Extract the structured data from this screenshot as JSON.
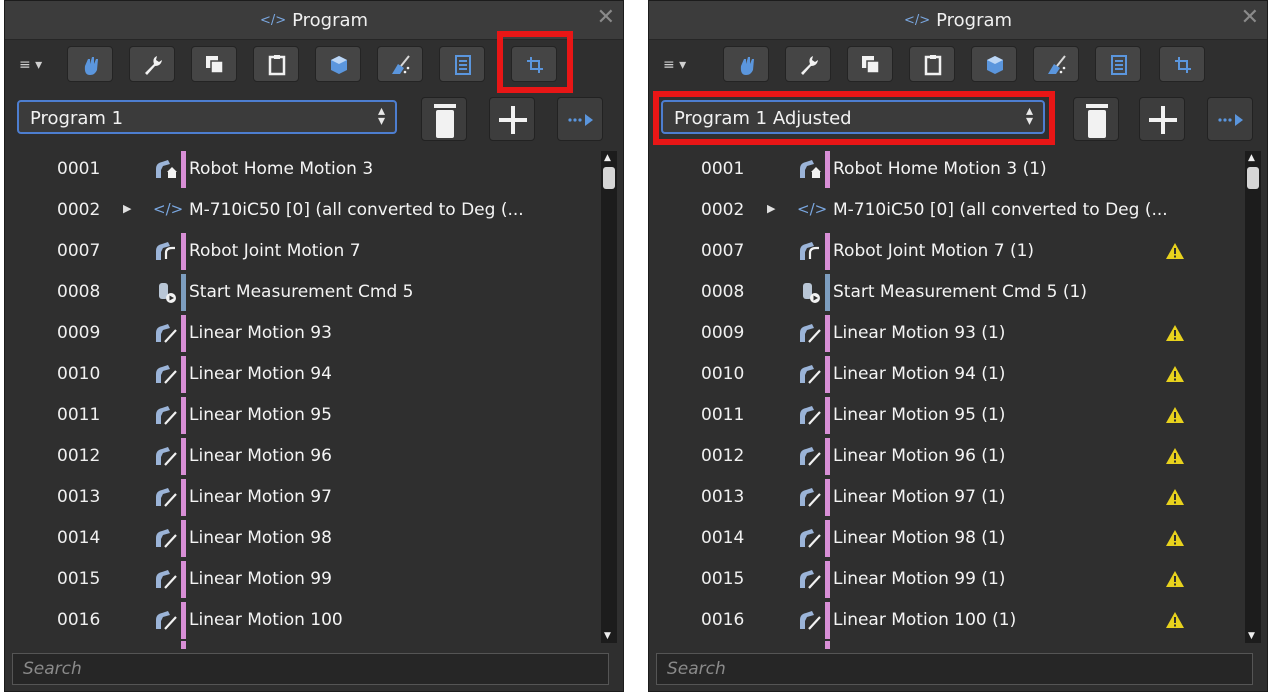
{
  "colors": {
    "panel_bg": "#2f2f2f",
    "accent_blue": "#4d7ed0",
    "highlight_red": "#e81616",
    "bar_pink": "#d88fd6",
    "bar_blue": "#7d9ec0",
    "warning_yellow": "#e8d21d"
  },
  "panels": [
    {
      "title": "Program",
      "toolbar_icons": [
        "hand-icon",
        "wrench-icon",
        "copy-icon",
        "clipboard-icon",
        "cube-icon",
        "broom-icon",
        "list-icon",
        "crop-icon"
      ],
      "highlighted": "crop-button",
      "program_select": {
        "value": "Program 1",
        "highlighted": false
      },
      "rows": [
        {
          "num": "0001",
          "label": "Robot Home Motion 3",
          "icon": "robot-home-icon",
          "bar": "pink",
          "warning": false,
          "expandable": false
        },
        {
          "num": "0002",
          "label": "M-710iC50 [0] (all converted to Deg (...",
          "icon": "code-icon",
          "bar": "none",
          "warning": false,
          "expandable": true
        },
        {
          "num": "0007",
          "label": "Robot Joint Motion 7",
          "icon": "robot-joint-icon",
          "bar": "pink",
          "warning": false,
          "expandable": false
        },
        {
          "num": "0008",
          "label": "Start Measurement Cmd 5",
          "icon": "measurement-icon",
          "bar": "blue",
          "warning": false,
          "expandable": false
        },
        {
          "num": "0009",
          "label": "Linear Motion 93",
          "icon": "linear-motion-icon",
          "bar": "pink",
          "warning": false,
          "expandable": false
        },
        {
          "num": "0010",
          "label": "Linear Motion 94",
          "icon": "linear-motion-icon",
          "bar": "pink",
          "warning": false,
          "expandable": false
        },
        {
          "num": "0011",
          "label": "Linear Motion 95",
          "icon": "linear-motion-icon",
          "bar": "pink",
          "warning": false,
          "expandable": false
        },
        {
          "num": "0012",
          "label": "Linear Motion 96",
          "icon": "linear-motion-icon",
          "bar": "pink",
          "warning": false,
          "expandable": false
        },
        {
          "num": "0013",
          "label": "Linear Motion 97",
          "icon": "linear-motion-icon",
          "bar": "pink",
          "warning": false,
          "expandable": false
        },
        {
          "num": "0014",
          "label": "Linear Motion 98",
          "icon": "linear-motion-icon",
          "bar": "pink",
          "warning": false,
          "expandable": false
        },
        {
          "num": "0015",
          "label": "Linear Motion 99",
          "icon": "linear-motion-icon",
          "bar": "pink",
          "warning": false,
          "expandable": false
        },
        {
          "num": "0016",
          "label": "Linear Motion 100",
          "icon": "linear-motion-icon",
          "bar": "pink",
          "warning": false,
          "expandable": false
        }
      ],
      "search_placeholder": "Search"
    },
    {
      "title": "Program",
      "toolbar_icons": [
        "hand-icon",
        "wrench-icon",
        "copy-icon",
        "clipboard-icon",
        "cube-icon",
        "broom-icon",
        "list-icon",
        "crop-icon"
      ],
      "highlighted": "program-select",
      "program_select": {
        "value": "Program 1 Adjusted",
        "highlighted": true
      },
      "rows": [
        {
          "num": "0001",
          "label": "Robot Home Motion 3 (1)",
          "icon": "robot-home-icon",
          "bar": "pink",
          "warning": false,
          "expandable": false
        },
        {
          "num": "0002",
          "label": "M-710iC50 [0] (all converted to Deg (...",
          "icon": "code-icon",
          "bar": "none",
          "warning": false,
          "expandable": true
        },
        {
          "num": "0007",
          "label": "Robot Joint Motion 7 (1)",
          "icon": "robot-joint-icon",
          "bar": "pink",
          "warning": true,
          "expandable": false
        },
        {
          "num": "0008",
          "label": "Start Measurement Cmd 5 (1)",
          "icon": "measurement-icon",
          "bar": "blue",
          "warning": false,
          "expandable": false
        },
        {
          "num": "0009",
          "label": "Linear Motion 93 (1)",
          "icon": "linear-motion-icon",
          "bar": "pink",
          "warning": true,
          "expandable": false
        },
        {
          "num": "0010",
          "label": "Linear Motion 94 (1)",
          "icon": "linear-motion-icon",
          "bar": "pink",
          "warning": true,
          "expandable": false
        },
        {
          "num": "0011",
          "label": "Linear Motion 95 (1)",
          "icon": "linear-motion-icon",
          "bar": "pink",
          "warning": true,
          "expandable": false
        },
        {
          "num": "0012",
          "label": "Linear Motion 96 (1)",
          "icon": "linear-motion-icon",
          "bar": "pink",
          "warning": true,
          "expandable": false
        },
        {
          "num": "0013",
          "label": "Linear Motion 97 (1)",
          "icon": "linear-motion-icon",
          "bar": "pink",
          "warning": true,
          "expandable": false
        },
        {
          "num": "0014",
          "label": "Linear Motion 98 (1)",
          "icon": "linear-motion-icon",
          "bar": "pink",
          "warning": true,
          "expandable": false
        },
        {
          "num": "0015",
          "label": "Linear Motion 99 (1)",
          "icon": "linear-motion-icon",
          "bar": "pink",
          "warning": true,
          "expandable": false
        },
        {
          "num": "0016",
          "label": "Linear Motion 100 (1)",
          "icon": "linear-motion-icon",
          "bar": "pink",
          "warning": true,
          "expandable": false
        }
      ],
      "search_placeholder": "Search"
    }
  ]
}
